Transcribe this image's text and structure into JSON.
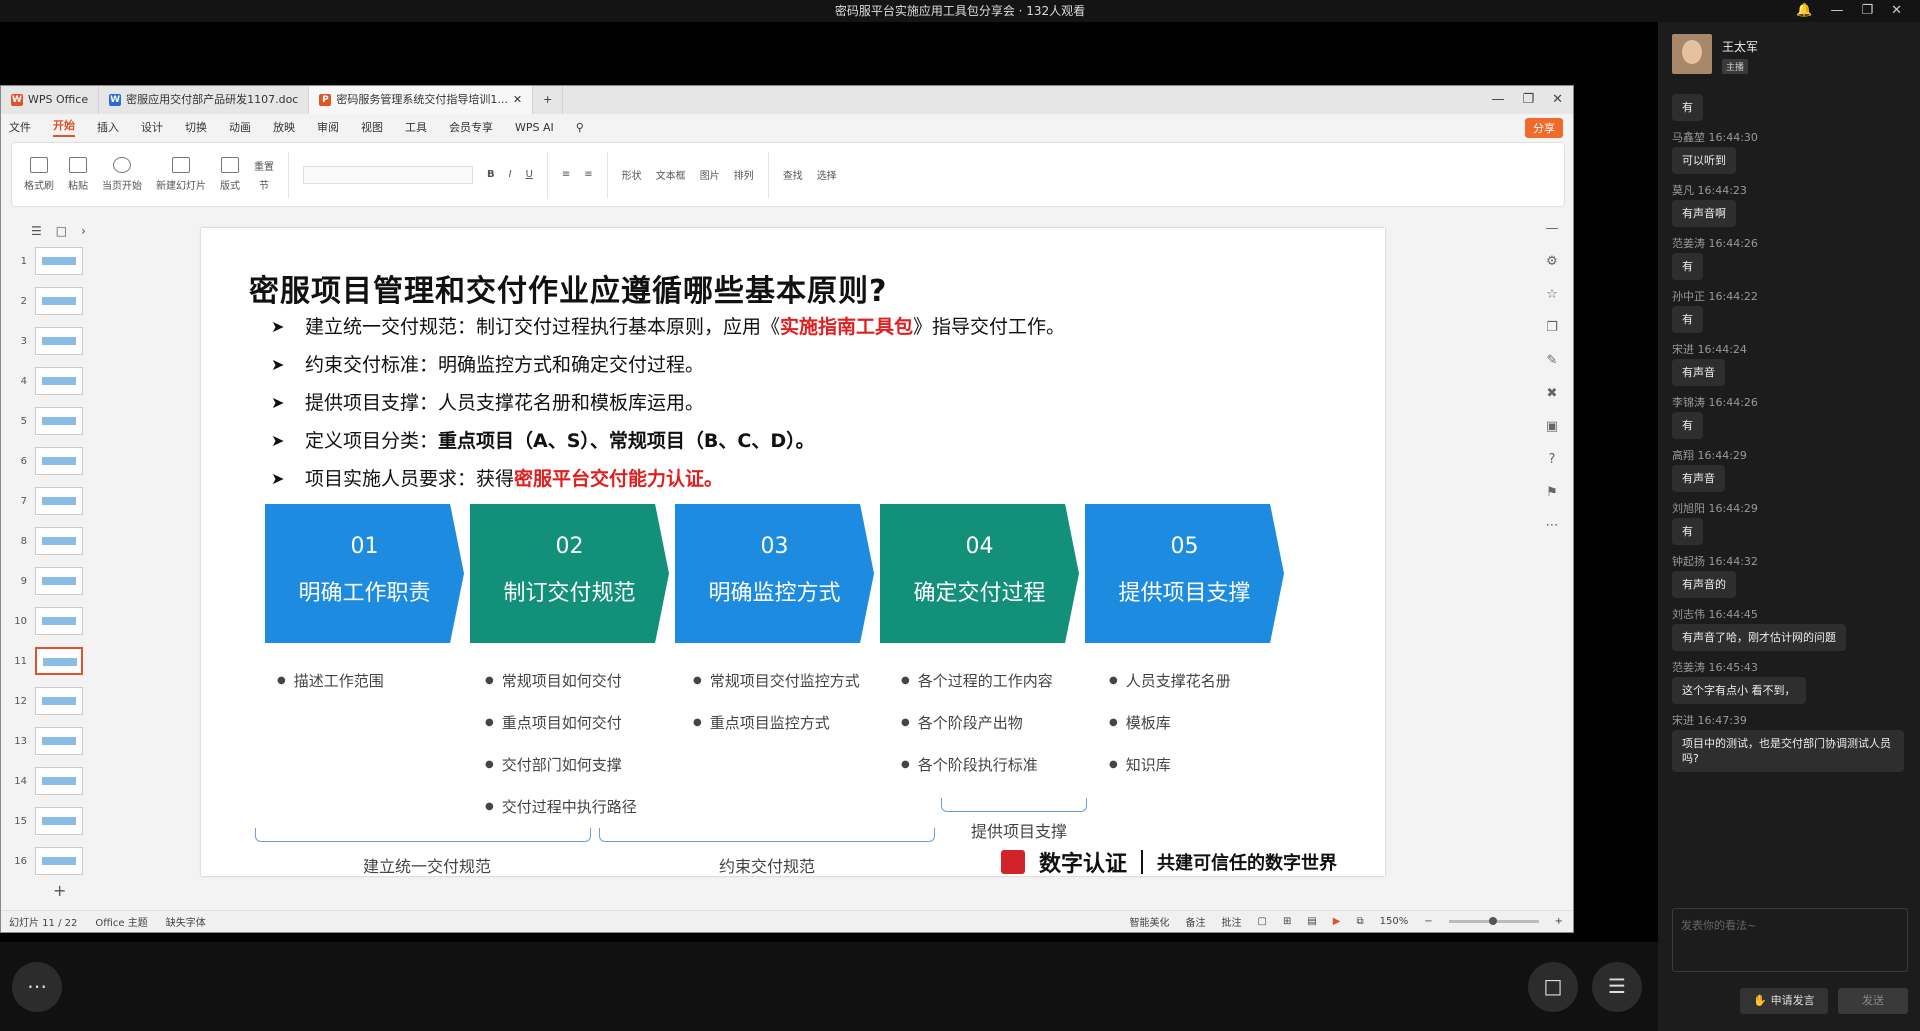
{
  "window": {
    "title": "密码服平台实施应用工具包分享会 · 132人观看"
  },
  "wps": {
    "tabs": [
      {
        "label": "WPS Office",
        "icon": "W"
      },
      {
        "label": "密服应用交付部产品研发1107.doc",
        "icon": "W"
      },
      {
        "label": "密码服务管理系统交付指导培训1...",
        "icon": "P"
      }
    ],
    "menus": [
      "文件",
      "开始",
      "插入",
      "设计",
      "切换",
      "动画",
      "放映",
      "审阅",
      "视图",
      "工具",
      "会员专享",
      "WPS AI"
    ],
    "share": "分享",
    "ribbon": [
      "格式刷",
      "粘贴",
      "当页开始",
      "新建幻灯片",
      "版式",
      "节",
      "重置",
      "形状",
      "图片",
      "文本框",
      "排列",
      "查找",
      "选择"
    ],
    "thumb_numbers": [
      "1",
      "2",
      "3",
      "4",
      "5",
      "6",
      "7",
      "8",
      "9",
      "10",
      "11",
      "12",
      "13",
      "14",
      "15",
      "16"
    ],
    "selected_slide": "11",
    "status": {
      "slide": "幻灯片 11 / 22",
      "theme": "Office 主题",
      "font": "缺失字体",
      "beautify": "智能美化",
      "notes": "备注",
      "comment": "批注",
      "zoom": "150%"
    }
  },
  "slide": {
    "title": "密服项目管理和交付作业应遵循哪些基本原则?",
    "bullets": [
      {
        "pre": "建立统一交付规范：制订交付过程执行基本原则，应用《",
        "red": "实施指南工具包",
        "post": "》指导交付工作。",
        "bold": ""
      },
      {
        "pre": "约束交付标准：明确监控方式和确定交付过程。",
        "red": "",
        "post": "",
        "bold": ""
      },
      {
        "pre": "提供项目支撑：人员支撑花名册和模板库运用。",
        "red": "",
        "post": "",
        "bold": ""
      },
      {
        "pre": "定义项目分类：",
        "red": "",
        "post": "",
        "bold": "重点项目（A、S）、常规项目（B、C、D）。"
      },
      {
        "pre": "项目实施人员要求：获得",
        "red": "密服平台交付能力认证。",
        "post": "",
        "bold": ""
      }
    ],
    "steps": [
      {
        "no": "01",
        "label": "明确工作职责",
        "color": "blue"
      },
      {
        "no": "02",
        "label": "制订交付规范",
        "color": "green"
      },
      {
        "no": "03",
        "label": "明确监控方式",
        "color": "blue"
      },
      {
        "no": "04",
        "label": "确定交付过程",
        "color": "green"
      },
      {
        "no": "05",
        "label": "提供项目支撑",
        "color": "blue"
      }
    ],
    "columns": [
      [
        "描述工作范围"
      ],
      [
        "常规项目如何交付",
        "重点项目如何交付",
        "交付部门如何支撑",
        "交付过程中执行路径"
      ],
      [
        "常规项目交付监控方式",
        "重点项目监控方式"
      ],
      [
        "各个过程的工作内容",
        "各个阶段产出物",
        "各个阶段执行标准"
      ],
      [
        "人员支撑花名册",
        "模板库",
        "知识库"
      ]
    ],
    "brace_labels": {
      "left": "建立统一交付规范",
      "mid": "约束交付规范",
      "right": "提供项目支撑"
    },
    "logo": {
      "name": "数字认证",
      "slogan": "共建可信任的数字世界"
    }
  },
  "chat": {
    "host": {
      "name": "王太军",
      "tag": "主播"
    },
    "messages": [
      {
        "who": "",
        "text": "有"
      },
      {
        "who": "马鑫堃 16:44:30",
        "text": "可以听到"
      },
      {
        "who": "莫凡 16:44:23",
        "text": "有声音啊"
      },
      {
        "who": "范姜涛 16:44:26",
        "text": "有"
      },
      {
        "who": "孙中正 16:44:22",
        "text": "有"
      },
      {
        "who": "宋进 16:44:24",
        "text": "有声音"
      },
      {
        "who": "李锦涛 16:44:26",
        "text": "有"
      },
      {
        "who": "高翔 16:44:29",
        "text": "有声音"
      },
      {
        "who": "刘旭阳 16:44:29",
        "text": "有"
      },
      {
        "who": "钟起扬 16:44:32",
        "text": "有声音的"
      },
      {
        "who": "刘志伟 16:44:45",
        "text": "有声音了哈，刚才估计网的问题"
      },
      {
        "who": "范姜涛 16:45:43",
        "text": "这个字有点小 看不到，"
      },
      {
        "who": "宋进 16:47:39",
        "text": "项目中的测试，也是交付部门协调测试人员吗?"
      }
    ],
    "input_placeholder": "发表你的看法~",
    "apply_label": "申请发言",
    "send_label": "发送"
  },
  "colors": {
    "blue": "#1d8be0",
    "green": "#12907a",
    "red": "#e02020",
    "accent": "#e0542a"
  }
}
